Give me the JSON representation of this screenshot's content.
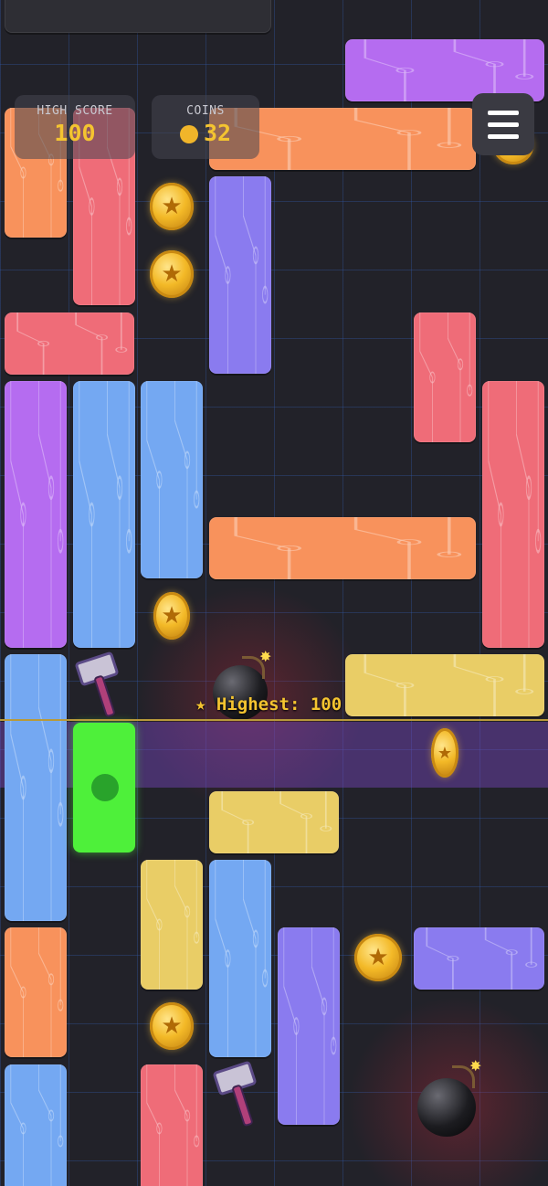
{
  "hud": {
    "high_score_label": "HIGH SCORE",
    "high_score_value": "100",
    "coins_label": "COINS",
    "coins_value": "32",
    "coin_glyph": "★"
  },
  "highest_marker": {
    "text": "★ Highest: 100"
  },
  "menu": {
    "icon": "hamburger-menu-icon"
  },
  "colors": {
    "orange": "#f8925c",
    "red": "#ef6c78",
    "purple": "#b56cf0",
    "blue": "#74a8f2",
    "indigo": "#8a7bef",
    "yellow": "#e9cd66",
    "green_player": "#4ef03a",
    "gold": "#f4c430",
    "background": "#222229",
    "grid": "#325aaa"
  },
  "blocks": [
    {
      "color": "orange"
    },
    {
      "color": "red"
    },
    {
      "color": "purple"
    },
    {
      "color": "orange"
    },
    {
      "color": "indigo"
    },
    {
      "color": "red"
    },
    {
      "color": "red"
    },
    {
      "color": "red"
    },
    {
      "color": "purple"
    },
    {
      "color": "blue"
    },
    {
      "color": "blue"
    },
    {
      "color": "orange"
    },
    {
      "color": "yellow"
    },
    {
      "color": "blue"
    },
    {
      "color": "green"
    },
    {
      "color": "yellow"
    },
    {
      "color": "yellow"
    },
    {
      "color": "blue"
    },
    {
      "color": "indigo"
    },
    {
      "color": "indigo"
    },
    {
      "color": "orange"
    },
    {
      "color": "blue"
    },
    {
      "color": "red"
    }
  ],
  "items": {
    "coins_on_board": 7,
    "bombs": 2,
    "hammers": 2
  }
}
